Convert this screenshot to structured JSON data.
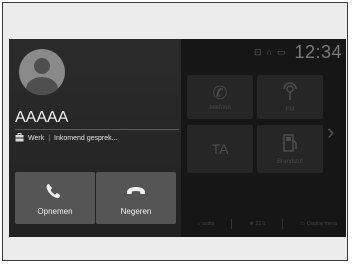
{
  "status": {
    "icons": "⊡ ∩ ▭",
    "clock": "12:34"
  },
  "home": {
    "tiles": [
      {
        "id": "phone",
        "icon": "phone-icon",
        "label": "telefoon",
        "glyph": "✆"
      },
      {
        "id": "fm",
        "icon": "antenna-icon",
        "label": "FM",
        "glyph": ""
      },
      {
        "id": "ta",
        "icon": "traffic-announcement-icon",
        "label": "",
        "glyph": "TA"
      },
      {
        "id": "fuel",
        "icon": "fuel-icon",
        "label": "Brandstof",
        "glyph": "⛽"
      }
    ],
    "bottom": [
      {
        "icon": "audio-icon",
        "label": "audio"
      },
      {
        "icon": "temp-icon",
        "label": "22.0"
      },
      {
        "icon": "display-icon",
        "label": "Display menu"
      }
    ]
  },
  "call": {
    "caller_name": "AAAAA",
    "category": "Werk",
    "status": "Inkomend gesprek...",
    "accept_label": "Opnemen",
    "decline_label": "Negeren"
  },
  "colors": {
    "screen_bg": "#161616",
    "panel_bg": "#262626",
    "button_bg": "#555555",
    "text": "#f2f2f2"
  }
}
